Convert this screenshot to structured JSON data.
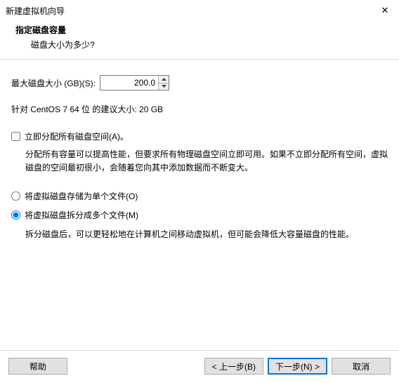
{
  "window": {
    "title": "新建虚拟机向导",
    "close_icon": "✕"
  },
  "header": {
    "heading": "指定磁盘容量",
    "subheading": "磁盘大小为多少?"
  },
  "disk": {
    "size_label": "最大磁盘大小 (GB)(S):",
    "size_value": "200.0",
    "hint": "针对 CentOS 7 64 位 的建议大小: 20 GB"
  },
  "allocate": {
    "checkbox_label": "立即分配所有磁盘空间(A)。",
    "desc": "分配所有容量可以提高性能，但要求所有物理磁盘空间立即可用。如果不立即分配所有空间，虚拟磁盘的空间最初很小，会随着您向其中添加数据而不断变大。"
  },
  "store": {
    "single_label": "将虚拟磁盘存储为单个文件(O)",
    "split_label": "将虚拟磁盘拆分成多个文件(M)",
    "split_desc": "拆分磁盘后，可以更轻松地在计算机之间移动虚拟机，但可能会降低大容量磁盘的性能。"
  },
  "footer": {
    "help": "帮助",
    "back": "< 上一步(B)",
    "next": "下一步(N) >",
    "cancel": "取消"
  }
}
